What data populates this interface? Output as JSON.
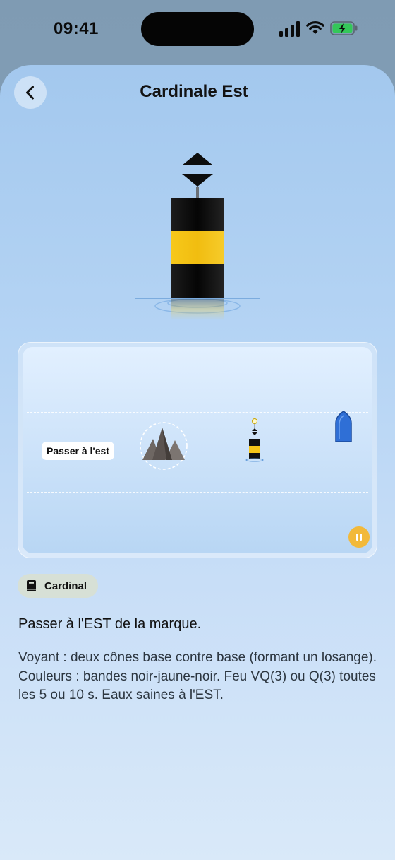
{
  "status": {
    "time": "09:41"
  },
  "header": {
    "title": "Cardinale Est"
  },
  "scene": {
    "pass_label": "Passer à l'est"
  },
  "badge": {
    "label": "Cardinal"
  },
  "content": {
    "heading": "Passer à l'EST de la marque.",
    "description": "Voyant : deux cônes base contre base (formant un losange). Couleurs : bandes noir-jaune-noir. Feu VQ(3) ou Q(3) toutes les 5 ou 10 s. Eaux saines à l'EST."
  },
  "icons": {
    "back": "chevron-left-icon",
    "signal": "cellular-signal-icon",
    "wifi": "wifi-icon",
    "battery": "battery-charging-icon",
    "badge": "book-icon",
    "pause": "pause-icon"
  },
  "colors": {
    "buoy_black": "#111111",
    "buoy_yellow": "#f5c518",
    "boat_blue": "#2f6fd6",
    "pause_orange": "#f2b93a",
    "battery_green": "#34c759"
  }
}
